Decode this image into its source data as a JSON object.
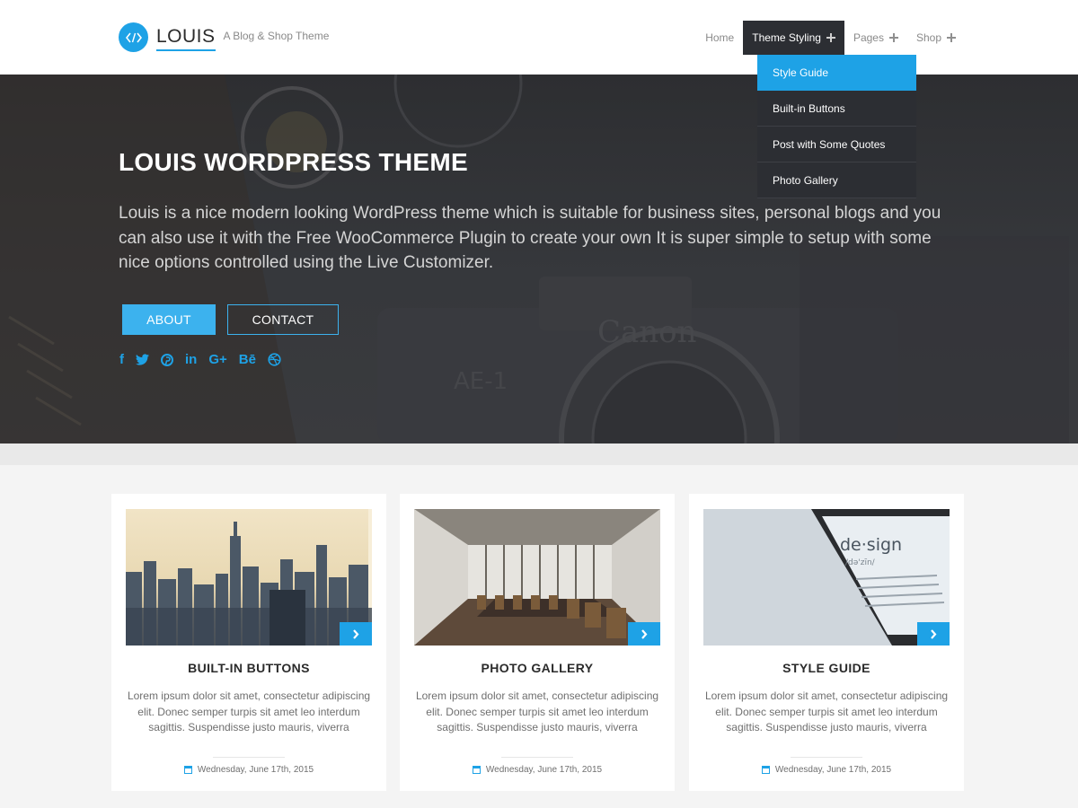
{
  "brand": {
    "name": "LOUIS",
    "tagline": "A Blog & Shop Theme",
    "accent_color": "#1ea2e6",
    "logo_icon": "code-icon"
  },
  "nav": {
    "items": [
      {
        "label": "Home"
      },
      {
        "label": "Theme Styling"
      },
      {
        "label": "Pages"
      },
      {
        "label": "Shop"
      }
    ],
    "dropdown": [
      {
        "label": "Style Guide"
      },
      {
        "label": "Built-in Buttons"
      },
      {
        "label": "Post with Some Quotes"
      },
      {
        "label": "Photo Gallery"
      }
    ]
  },
  "hero": {
    "title": "LOUIS WORDPRESS THEME",
    "text": "Louis is a nice modern looking WordPress theme which is suitable for business sites, personal blogs and you can also use it with the Free WooCommerce Plugin to create your own It is super simple to setup with some nice options controlled using the Live Customizer.",
    "about_label": "ABOUT",
    "contact_label": "CONTACT",
    "social": [
      {
        "icon": "facebook-icon",
        "glyph": "f"
      },
      {
        "icon": "twitter-icon",
        "glyph": "🐦"
      },
      {
        "icon": "pinterest-icon",
        "glyph": "℗"
      },
      {
        "icon": "linkedin-icon",
        "glyph": "in"
      },
      {
        "icon": "google-plus-icon",
        "glyph": "G+"
      },
      {
        "icon": "behance-icon",
        "glyph": "Bē"
      },
      {
        "icon": "dribbble-icon",
        "glyph": "⊛"
      }
    ]
  },
  "posts": [
    {
      "title": "BUILT-IN BUTTONS",
      "excerpt": "Lorem ipsum dolor sit amet, consectetur adipiscing elit. Donec semper turpis sit amet leo interdum sagittis. Suspendisse justo mauris, viverra",
      "date": "Wednesday, June 17th, 2015"
    },
    {
      "title": "PHOTO GALLERY",
      "excerpt": "Lorem ipsum dolor sit amet, consectetur adipiscing elit. Donec semper turpis sit amet leo interdum sagittis. Suspendisse justo mauris, viverra",
      "date": "Wednesday, June 17th, 2015"
    },
    {
      "title": "STYLE GUIDE",
      "excerpt": "Lorem ipsum dolor sit amet, consectetur adipiscing elit. Donec semper turpis sit amet leo interdum sagittis. Suspendisse justo mauris, viverra",
      "date": "Wednesday, June 17th, 2015",
      "image_text": "de·sign",
      "image_subtext": "/də'zīn/"
    }
  ]
}
